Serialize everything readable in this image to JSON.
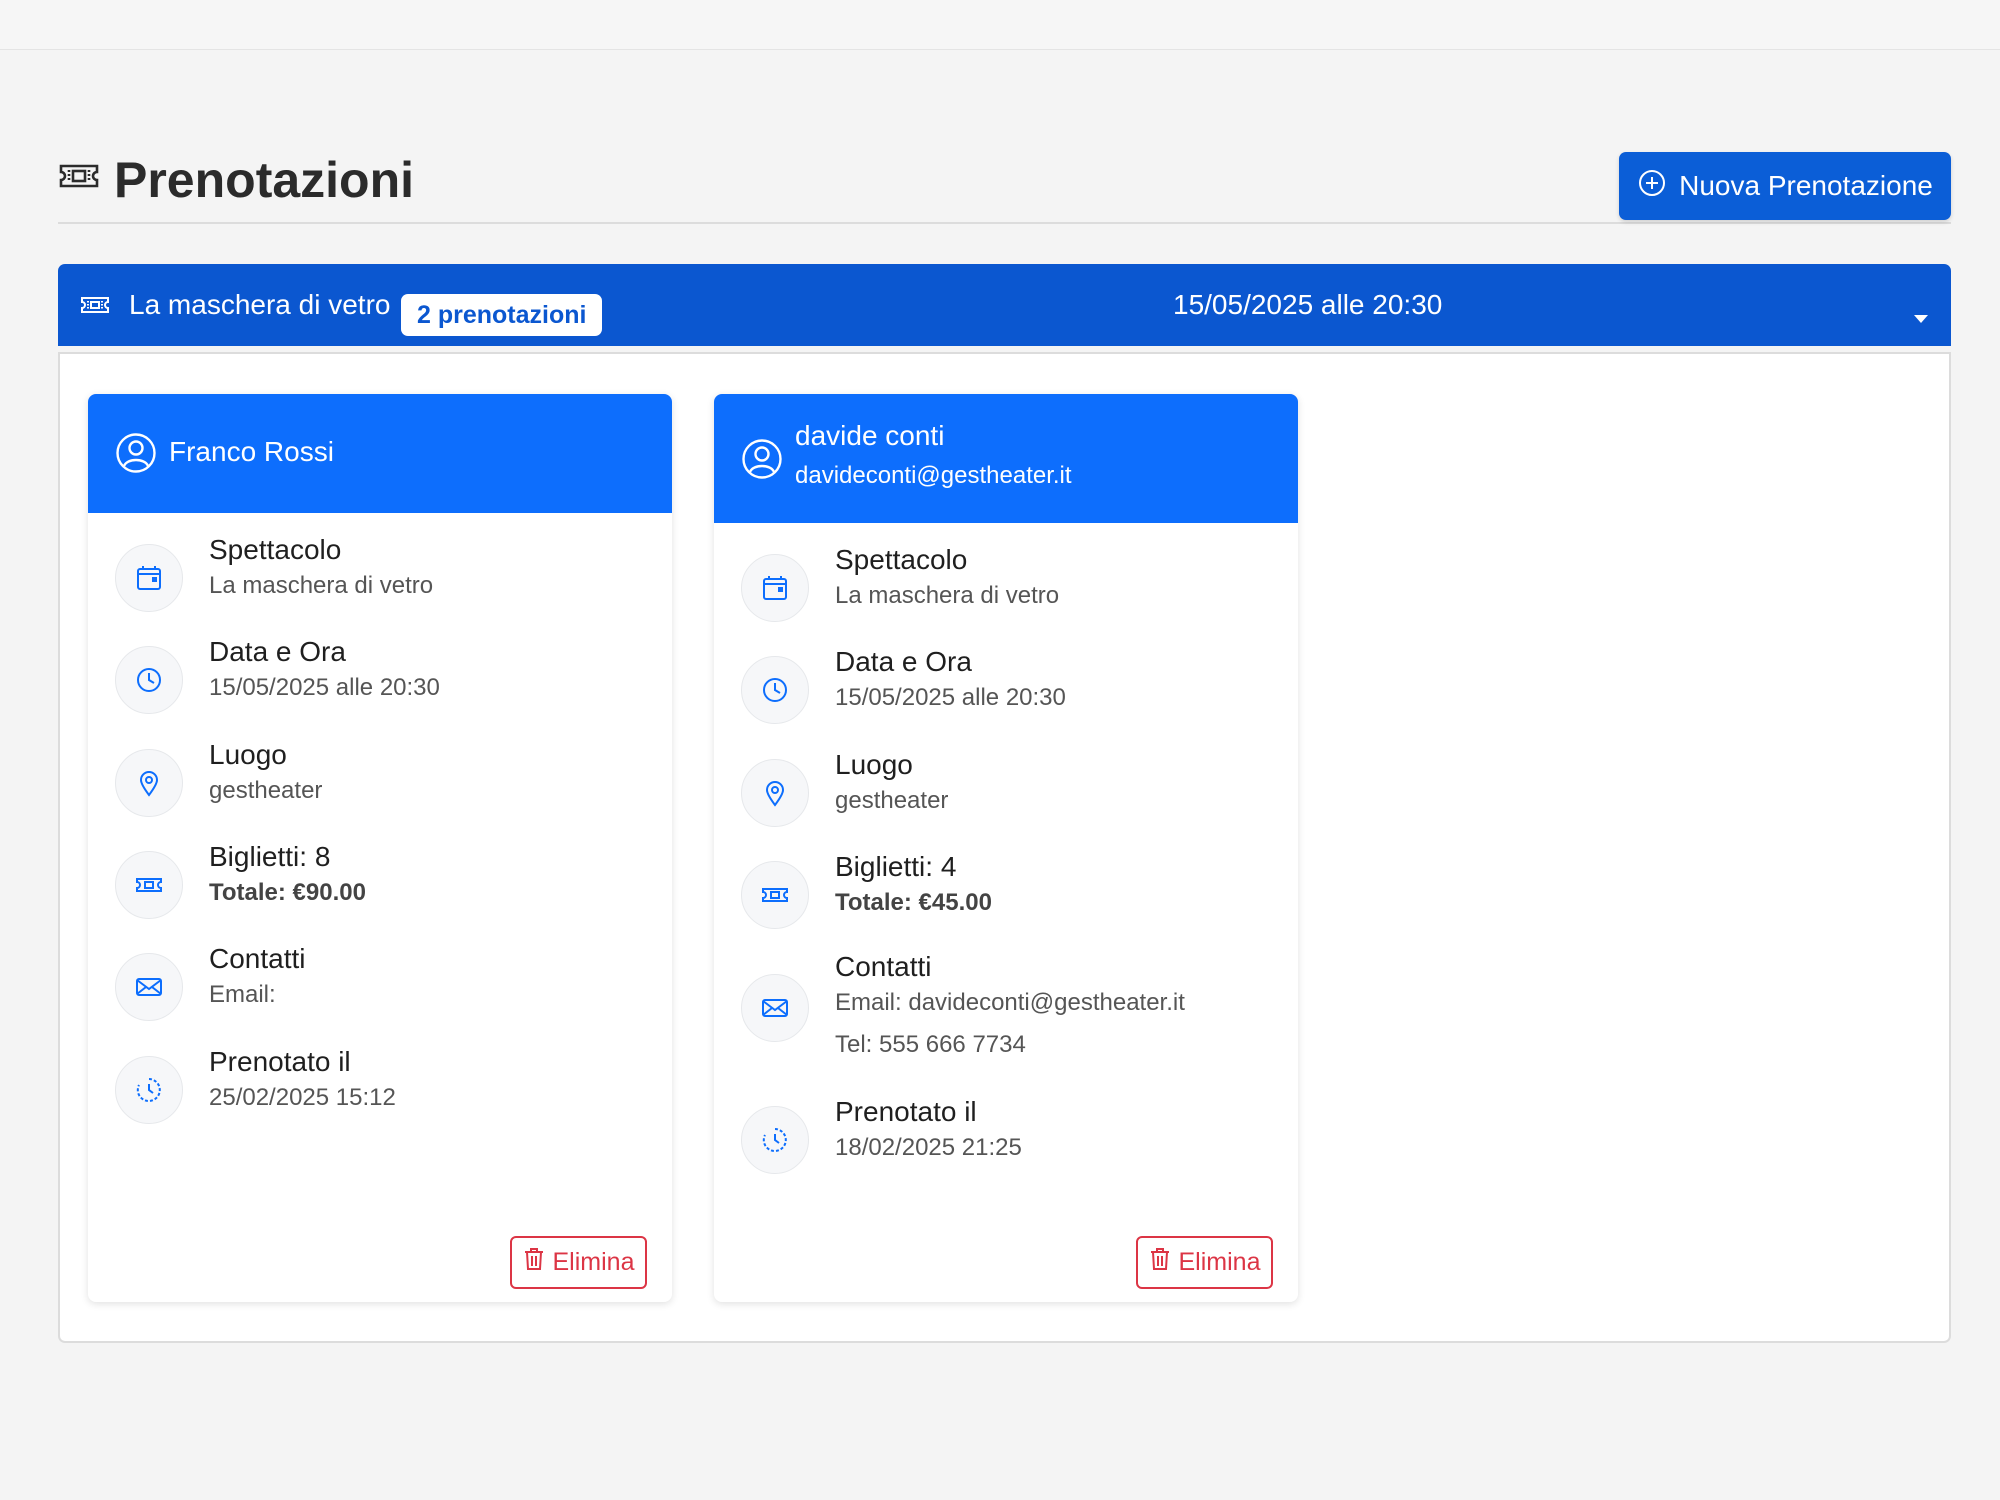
{
  "page": {
    "title": "Prenotazioni",
    "title_icon": "ticket-icon",
    "new_button_label": "Nuova Prenotazione",
    "new_button_icon": "plus-circle-icon"
  },
  "colors": {
    "primary": "#0d6efd",
    "primary_dark": "#0b57d0",
    "danger": "#dc3545",
    "background": "#f4f4f4"
  },
  "show_group": {
    "title": "La maschera di vetro",
    "badge": "2 prenotazioni",
    "date": "15/05/2025 alle 20:30",
    "icon": "ticket-icon",
    "toggle_icon": "caret-down-icon"
  },
  "bookings": [
    {
      "name": "Franco Rossi",
      "email_header": "",
      "show_label": "Spettacolo",
      "show_value": "La maschera di vetro",
      "datetime_label": "Data e Ora",
      "datetime_value": "15/05/2025 alle 20:30",
      "place_label": "Luogo",
      "place_value": "gestheater",
      "tickets_label": "Biglietti: 8",
      "total_value": "Totale: €90.00",
      "contacts_label": "Contatti",
      "contacts_email": "Email:",
      "contacts_phone": "",
      "booked_label": "Prenotato il",
      "booked_value": "25/02/2025 15:12",
      "delete_label": "Elimina"
    },
    {
      "name": "davide conti",
      "email_header": "davideconti@gestheater.it",
      "show_label": "Spettacolo",
      "show_value": "La maschera di vetro",
      "datetime_label": "Data e Ora",
      "datetime_value": "15/05/2025 alle 20:30",
      "place_label": "Luogo",
      "place_value": "gestheater",
      "tickets_label": "Biglietti: 4",
      "total_value": "Totale: €45.00",
      "contacts_label": "Contatti",
      "contacts_email": "Email: davideconti@gestheater.it",
      "contacts_phone": "Tel: 555 666 7734",
      "booked_label": "Prenotato il",
      "booked_value": "18/02/2025 21:25",
      "delete_label": "Elimina"
    }
  ]
}
